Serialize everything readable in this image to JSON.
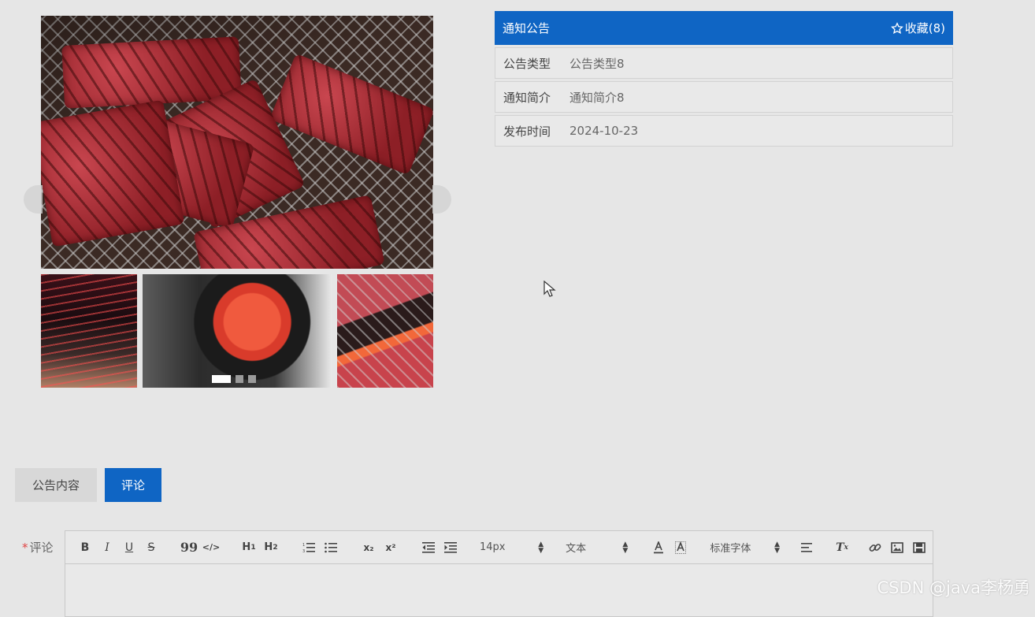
{
  "info_panel": {
    "title": "通知公告",
    "favorite_label": "收藏(8)",
    "favorite_icon": "star-outline-icon",
    "rows": [
      {
        "label": "公告类型",
        "value": "公告类型8"
      },
      {
        "label": "通知简介",
        "value": "通知简介8"
      },
      {
        "label": "发布时间",
        "value": "2024-10-23"
      }
    ]
  },
  "carousel": {
    "main_image": "grilled-wagyu-beef-photo",
    "thumbnails": [
      "restaurant-interior-photo",
      "spicy-crayfish-stew-photo",
      "grilled-pork-belly-photo"
    ],
    "page_count": 3,
    "active_page": 1
  },
  "tabs": [
    {
      "label": "公告内容",
      "active": false
    },
    {
      "label": "评论",
      "active": true
    }
  ],
  "comment": {
    "required_mark": "*",
    "label": "评论",
    "toolbar": {
      "bold": "B",
      "italic": "I",
      "underline": "U",
      "strike": "S",
      "blockquote": "99",
      "code": "</>",
      "h1": "H",
      "h1_sub": "1",
      "h2": "H",
      "h2_sub": "2",
      "subscript": "x₂",
      "superscript": "x²",
      "font_size": "14px",
      "header": "文本",
      "font_family": "标准字体",
      "clean": "T",
      "clean_sub": "x"
    }
  },
  "watermark": "CSDN @java李杨勇",
  "colors": {
    "accent": "#0f65c4",
    "background": "#e6e6e6",
    "required": "#e04444"
  }
}
